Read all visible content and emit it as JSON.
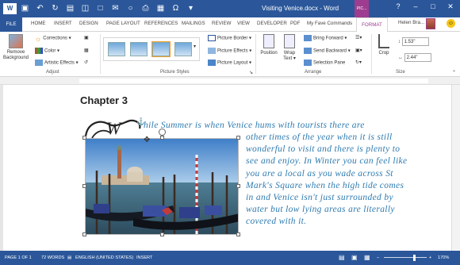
{
  "window": {
    "title": "Visiting Venice.docx - Word",
    "picture_tools_label": "PIC...",
    "controls": [
      "?",
      "–",
      "□",
      "✕"
    ]
  },
  "tabs": [
    "FILE",
    "HOME",
    "INSERT",
    "DESIGN",
    "PAGE LAYOUT",
    "REFERENCES",
    "MAILINGS",
    "REVIEW",
    "VIEW",
    "DEVELOPER",
    "PDF",
    "My Fave Commands",
    "FORMAT"
  ],
  "user": {
    "name": "Helen Bra... ▾"
  },
  "ribbon": {
    "adjust": {
      "remove_background": "Remove Background",
      "corrections": "Corrections ▾",
      "color": "Color ▾",
      "artistic_effects": "Artistic Effects ▾",
      "label": "Adjust"
    },
    "picture_styles": {
      "picture_border": "Picture Border ▾",
      "picture_effects": "Picture Effects ▾",
      "picture_layout": "Picture Layout ▾",
      "label": "Picture Styles"
    },
    "arrange": {
      "position": "Position",
      "wrap_text": "Wrap Text ▾",
      "bring_forward": "Bring Forward ▾",
      "send_backward": "Send Backward ▾",
      "selection_pane": "Selection Pane",
      "label": "Arrange"
    },
    "size": {
      "crop": "Crop",
      "height": "1.53\"",
      "width": "2.44\"",
      "label": "Size"
    }
  },
  "document": {
    "heading": "Chapter 3",
    "dropcap": "W",
    "lines": [
      "hile Summer is when Venice hums with tourists there are",
      "other times of the year when it is still",
      "wonderful to visit and there is plenty to",
      "see and enjoy. In Winter you can feel like",
      "you are a local as you wade across St",
      "Mark's Square when the high tide comes",
      "in and Venice isn't just surrounded by",
      "water but low lying areas are literally",
      "covered with it."
    ]
  },
  "status": {
    "page": "PAGE 1 OF 1",
    "words": "72 WORDS",
    "language": "ENGLISH (UNITED STATES)",
    "mode": "INSERT",
    "zoom": "170%"
  },
  "colors": {
    "word_blue": "#2b579a",
    "picture_tools": "#9e3d8f",
    "body_text": "#2f7bb0"
  }
}
